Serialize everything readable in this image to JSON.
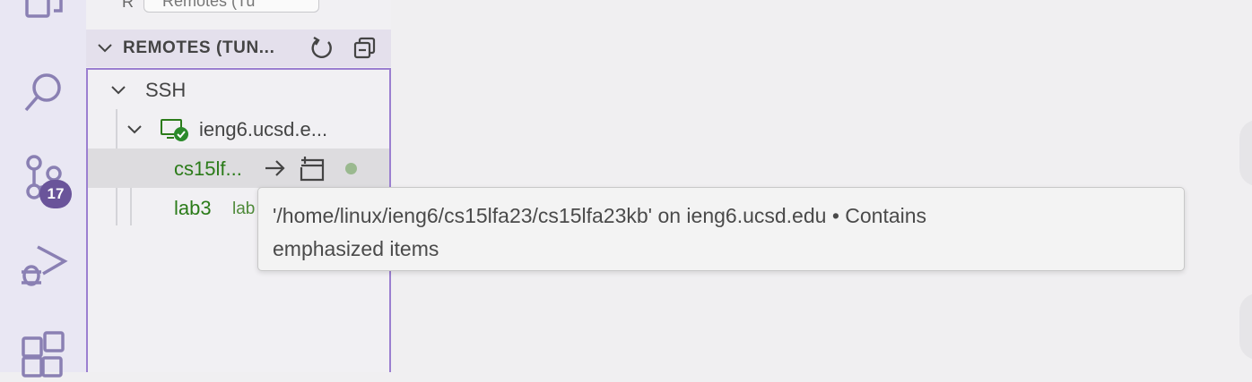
{
  "activity_bar": {
    "source_control_badge": "17"
  },
  "sidebar": {
    "top_letter": "R",
    "dropdown_value": "Remotes (Tu",
    "section": {
      "title": "REMOTES (TUN..."
    },
    "tree": {
      "ssh_label": "SSH",
      "host_label": "ieng6.ucsd.e...",
      "folder_label": "cs15lf...",
      "lab_label": "lab3",
      "lab_desc": "lab"
    }
  },
  "tooltip": {
    "line1": "'/home/linux/ieng6/cs15lfa23/cs15lfa23kb' on ieng6.ucsd.edu • Contains",
    "line2": "emphasized items"
  },
  "colors": {
    "accent": "#9b7fd0",
    "badge": "#6a549a",
    "tree_green": "#2b7b19"
  }
}
